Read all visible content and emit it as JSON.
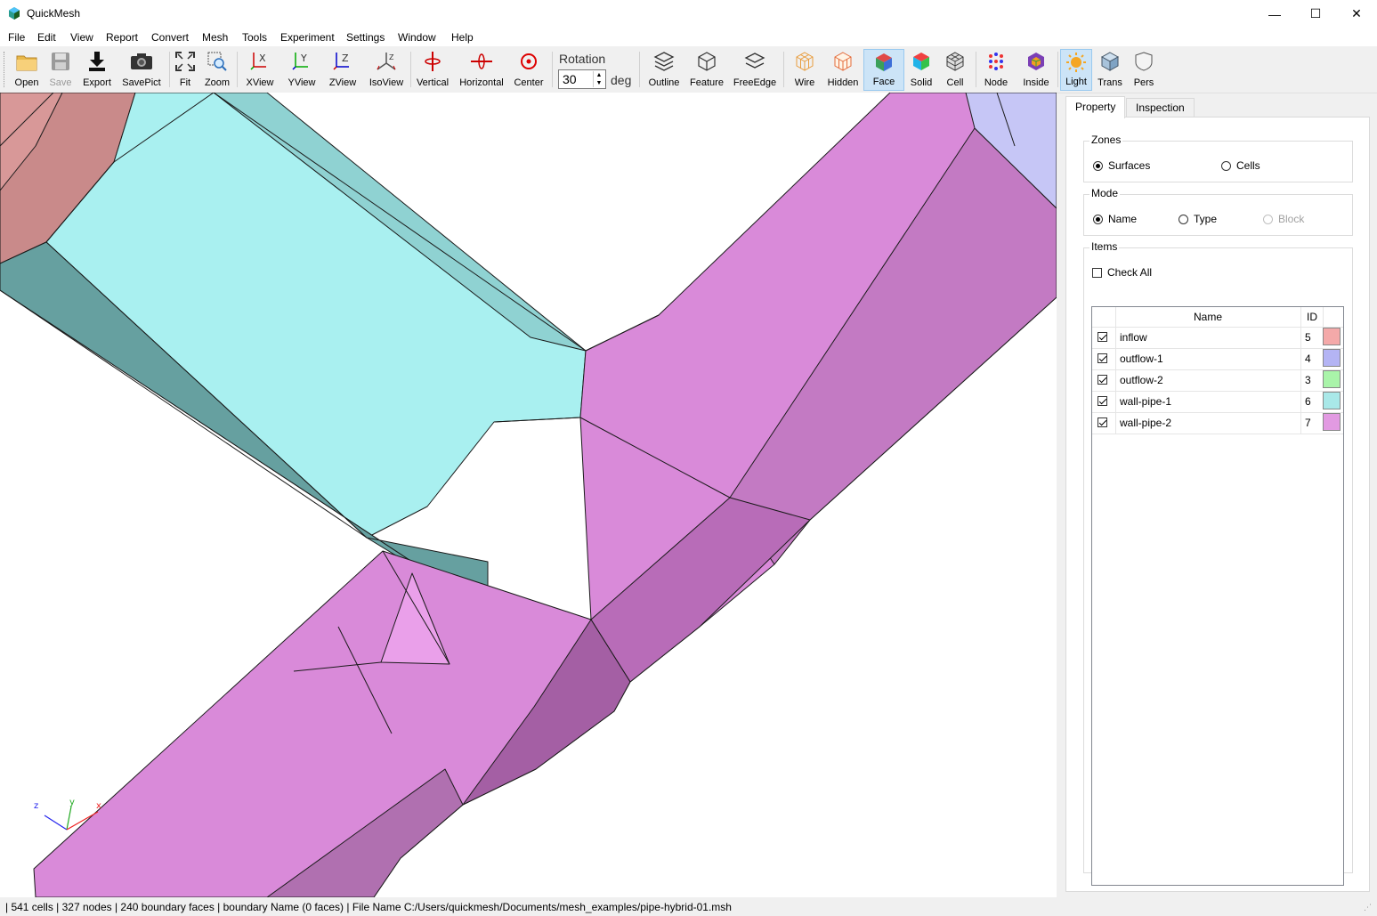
{
  "window": {
    "title": "QuickMesh"
  },
  "menu": [
    "File",
    "Edit",
    "View",
    "Report",
    "Convert",
    "Mesh",
    "Tools",
    "Experiment",
    "Settings",
    "Window",
    "Help"
  ],
  "toolbar": {
    "buttons": [
      {
        "id": "open",
        "label": "Open"
      },
      {
        "id": "save",
        "label": "Save"
      },
      {
        "id": "export",
        "label": "Export"
      },
      {
        "id": "savepict",
        "label": "SavePict"
      },
      {
        "id": "fit",
        "label": "Fit"
      },
      {
        "id": "zoom",
        "label": "Zoom"
      },
      {
        "id": "xview",
        "label": "XView"
      },
      {
        "id": "yview",
        "label": "YView"
      },
      {
        "id": "zview",
        "label": "ZView"
      },
      {
        "id": "isoview",
        "label": "IsoView"
      },
      {
        "id": "vertical",
        "label": "Vertical"
      },
      {
        "id": "horizontal",
        "label": "Horizontal"
      },
      {
        "id": "center",
        "label": "Center"
      },
      {
        "id": "outline",
        "label": "Outline"
      },
      {
        "id": "feature",
        "label": "Feature"
      },
      {
        "id": "freeedge",
        "label": "FreeEdge"
      },
      {
        "id": "wire",
        "label": "Wire"
      },
      {
        "id": "hidden",
        "label": "Hidden"
      },
      {
        "id": "face",
        "label": "Face"
      },
      {
        "id": "solid",
        "label": "Solid"
      },
      {
        "id": "cell",
        "label": "Cell"
      },
      {
        "id": "node",
        "label": "Node"
      },
      {
        "id": "inside",
        "label": "Inside"
      },
      {
        "id": "light",
        "label": "Light"
      },
      {
        "id": "trans",
        "label": "Trans"
      },
      {
        "id": "pers",
        "label": "Pers"
      }
    ],
    "rotation": {
      "label": "Rotation",
      "value": "30",
      "unit": "deg"
    }
  },
  "panel": {
    "tabs": [
      "Property",
      "Inspection"
    ],
    "zones": {
      "title": "Zones",
      "options": [
        "Surfaces",
        "Cells"
      ],
      "selected": "Surfaces"
    },
    "mode": {
      "title": "Mode",
      "options": [
        "Name",
        "Type",
        "Block"
      ],
      "selected": "Name",
      "disabled": "Block"
    },
    "items": {
      "title": "Items",
      "check_all": "Check All",
      "columns": [
        "Name",
        "ID"
      ],
      "rows": [
        {
          "name": "inflow",
          "id": "5",
          "color": "#f4a9a9",
          "checked": true
        },
        {
          "name": "outflow-1",
          "id": "4",
          "color": "#b4b4f4",
          "checked": true
        },
        {
          "name": "outflow-2",
          "id": "3",
          "color": "#a9f4a9",
          "checked": true
        },
        {
          "name": "wall-pipe-1",
          "id": "6",
          "color": "#a9e8e8",
          "checked": true
        },
        {
          "name": "wall-pipe-2",
          "id": "7",
          "color": "#e29ae2",
          "checked": true
        }
      ]
    }
  },
  "status": {
    "text": "| 541 cells | 327 nodes | 240 boundary faces |  boundary Name  (0 faces) | File Name C:/Users/quickmesh/Documents/mesh_examples/pipe-hybrid-01.msh"
  },
  "axes": {
    "x": "x",
    "y": "y",
    "z": "z"
  }
}
